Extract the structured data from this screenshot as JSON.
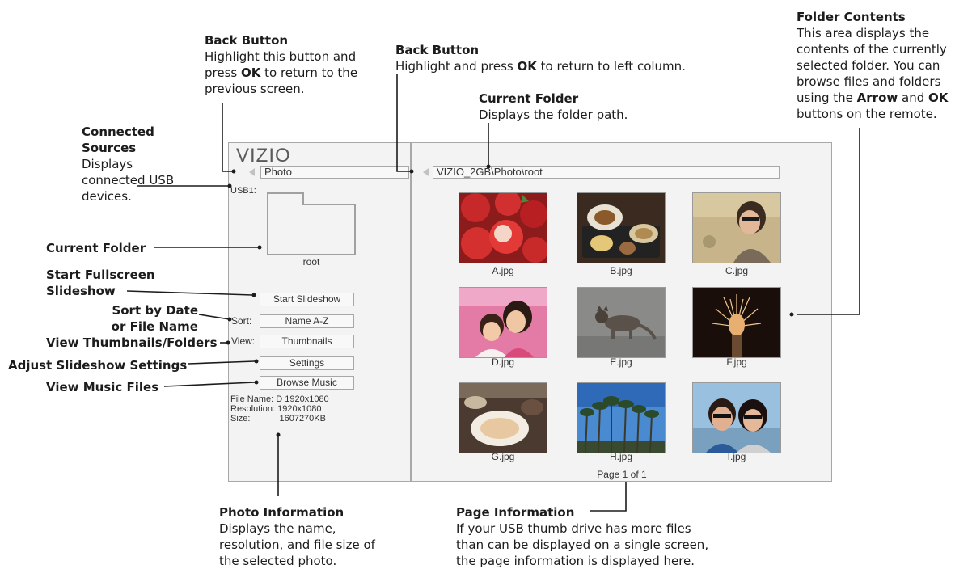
{
  "callouts": {
    "back_left": {
      "title": "Back Button",
      "desc_pre": "Highlight this button and press ",
      "desc_key": "OK",
      "desc_post": " to return to the previous screen."
    },
    "back_right": {
      "title": "Back Button",
      "desc_pre": "Highlight and press ",
      "desc_key": "OK",
      "desc_post": " to return to left column."
    },
    "current_folder_top": {
      "title": "Current Folder",
      "desc": "Displays the folder path."
    },
    "folder_contents": {
      "title": "Folder Contents",
      "desc_pre": "This area displays the contents of the currently selected folder. You can browse files and folders using the ",
      "key1": "Arrow",
      "desc_mid": " and ",
      "key2": "OK",
      "desc_post": " buttons on the remote."
    },
    "connected_sources": {
      "title_1": "Connected",
      "title_2": "Sources",
      "desc": "Displays connected USB devices."
    },
    "photo_info": {
      "title": "Photo Information",
      "desc": "Displays the name, resolution, and file size of the selected photo."
    },
    "page_info": {
      "title": "Page Information",
      "desc": "If your USB thumb drive has more files than can be displayed on a single screen, the page information is displayed here."
    }
  },
  "side_labels": {
    "current_folder": "Current Folder",
    "start_fullscreen_1": "Start Fullscreen",
    "start_fullscreen_2": "Slideshow",
    "sort_1": "Sort by Date",
    "sort_2": "or File Name",
    "view": "View Thumbnails/Folders",
    "settings": "Adjust Slideshow Settings",
    "music": "View Music Files"
  },
  "screen": {
    "logo": "VIZIO",
    "left_path": "Photo",
    "right_path": "VIZIO_2GB\\Photo\\root",
    "usb_label": "USB1:",
    "folder_name": "root",
    "menu": {
      "start_slideshow": "Start Slideshow",
      "sort_key": "Sort:",
      "sort_value": "Name A-Z",
      "view_key": "View:",
      "view_value": "Thumbnails",
      "settings": "Settings",
      "browse_music": "Browse Music"
    },
    "photo_info": {
      "file_name": "File Name: D 1920x1080",
      "resolution": "Resolution: 1920x1080",
      "size_key": "Size:",
      "size_value": "1607270KB"
    },
    "thumbnails": [
      "A.jpg",
      "B.jpg",
      "C.jpg",
      "D.jpg",
      "E.jpg",
      "F.jpg",
      "G.jpg",
      "H.jpg",
      "I.jpg"
    ],
    "page_info": "Page 1 of 1"
  },
  "colors": {
    "screen_bg": "#f3f3f3",
    "screen_border": "#a8a8a8",
    "callout_line": "#1c1c1c"
  }
}
